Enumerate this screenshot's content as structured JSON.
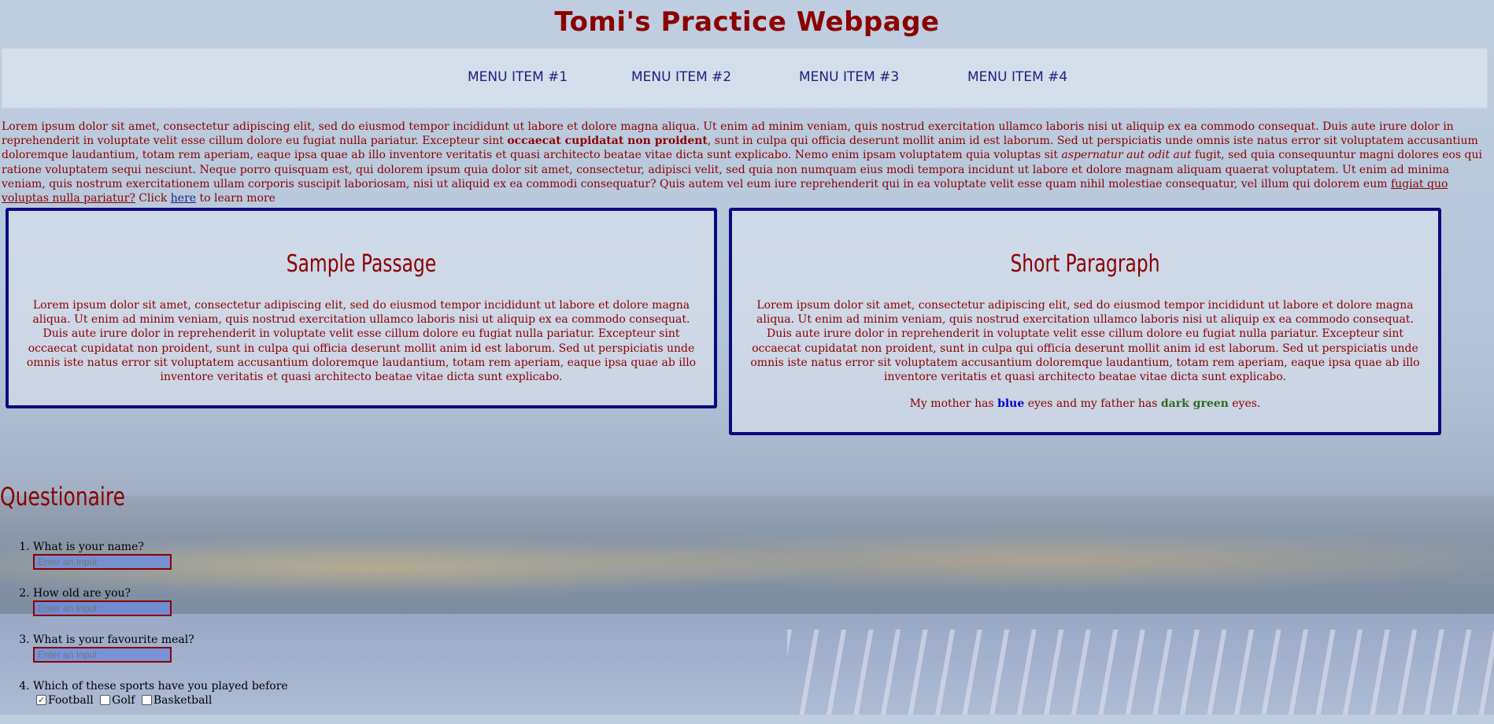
{
  "header": {
    "title": "Tomi's Practice Webpage"
  },
  "menu": [
    {
      "label": "MENU ITEM #1"
    },
    {
      "label": "MENU ITEM #2"
    },
    {
      "label": "MENU ITEM #3"
    },
    {
      "label": "MENU ITEM #4"
    }
  ],
  "intro": {
    "part1": "Lorem ipsum dolor sit amet, consectetur adipiscing elit, sed do eiusmod tempor incididunt ut labore et dolore magna aliqua. Ut enim ad minim veniam, quis nostrud exercitation ullamco laboris nisi ut aliquip ex ea commodo consequat. Duis aute irure dolor in reprehenderit in voluptate velit esse cillum dolore eu fugiat nulla pariatur. Excepteur sint ",
    "bold": "occaecat cupidatat non proident",
    "part2": ", sunt in culpa qui officia deserunt mollit anim id est laborum. Sed ut perspiciatis unde omnis iste natus error sit voluptatem accusantium doloremque laudantium, totam rem aperiam, eaque ipsa quae ab illo inventore veritatis et quasi architecto beatae vitae dicta sunt explicabo. Nemo enim ipsam voluptatem quia voluptas sit ",
    "italic": "aspernatur aut odit aut",
    "part3": " fugit, sed quia consequuntur magni dolores eos qui ratione voluptatem sequi nesciunt. Neque porro quisquam est, qui dolorem ipsum quia dolor sit amet, consectetur, adipisci velit, sed quia non numquam eius modi tempora incidunt ut labore et dolore magnam aliquam quaerat voluptatem. Ut enim ad minima veniam, quis nostrum exercitationem ullam corporis suscipit laboriosam, nisi ut aliquid ex ea commodi consequatur? Quis autem vel eum iure reprehenderit qui in ea voluptate velit esse quam nihil molestiae consequatur, vel illum qui dolorem eum ",
    "underline": "fugiat quo voluptas nulla pariatur?",
    "click_text": " Click ",
    "link_label": "here",
    "tail": " to learn more"
  },
  "boxes": {
    "sample": {
      "title": "Sample Passage",
      "text": "Lorem ipsum dolor sit amet, consectetur adipiscing elit, sed do eiusmod tempor incididunt ut labore et dolore magna aliqua. Ut enim ad minim veniam, quis nostrud exercitation ullamco laboris nisi ut aliquip ex ea commodo consequat. Duis aute irure dolor in reprehenderit in voluptate velit esse cillum dolore eu fugiat nulla pariatur. Excepteur sint occaecat cupidatat non proident, sunt in culpa qui officia deserunt mollit anim id est laborum. Sed ut perspiciatis unde omnis iste natus error sit voluptatem accusantium doloremque laudantium, totam rem aperiam, eaque ipsa quae ab illo inventore veritatis et quasi architecto beatae vitae dicta sunt explicabo."
    },
    "short": {
      "title": "Short Paragraph",
      "text": "Lorem ipsum dolor sit amet, consectetur adipiscing elit, sed do eiusmod tempor incididunt ut labore et dolore magna aliqua. Ut enim ad minim veniam, quis nostrud exercitation ullamco laboris nisi ut aliquip ex ea commodo consequat. Duis aute irure dolor in reprehenderit in voluptate velit esse cillum dolore eu fugiat nulla pariatur. Excepteur sint occaecat cupidatat non proident, sunt in culpa qui officia deserunt mollit anim id est laborum. Sed ut perspiciatis unde omnis iste natus error sit voluptatem accusantium doloremque laudantium, totam rem aperiam, eaque ipsa quae ab illo inventore veritatis et quasi architecto beatae vitae dicta sunt explicabo.",
      "eyes": {
        "pre": "My mother has ",
        "blue": "blue",
        "mid": " eyes and my father has ",
        "green": "dark green",
        "post": " eyes."
      }
    }
  },
  "questionnaire": {
    "title": "Questionaire",
    "questions": [
      {
        "label": "What is your name?",
        "placeholder": "Enter an Input"
      },
      {
        "label": "How old are you?",
        "placeholder": "Enter an Input"
      },
      {
        "label": "What is your favourite meal?",
        "placeholder": "Enter an Input"
      },
      {
        "label": "Which of these sports have you played before"
      }
    ],
    "sports": [
      {
        "label": "Football",
        "checked": true
      },
      {
        "label": "Golf",
        "checked": false
      },
      {
        "label": "Basketball",
        "checked": false
      }
    ]
  },
  "colors": {
    "title": "#8b0000",
    "menu_text": "#1a237e",
    "box_border": "#0a0a80",
    "input_bg": "#6e8cdc"
  }
}
